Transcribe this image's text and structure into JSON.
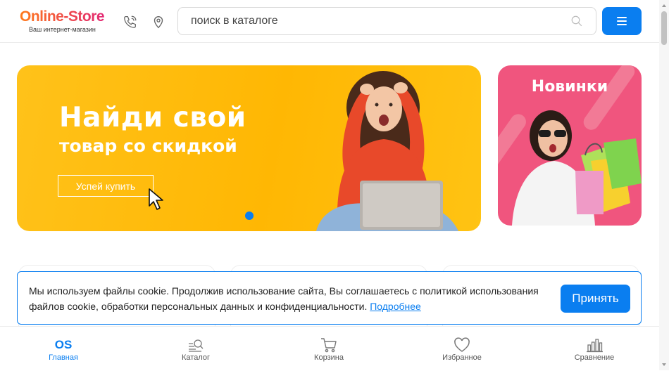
{
  "header": {
    "logo_name": "Online-Store",
    "logo_tagline": "Ваш интернет-магазин",
    "search_placeholder": "поиск в каталоге",
    "icons": [
      "phone-icon",
      "location-pin-icon",
      "search-icon",
      "menu-icon"
    ]
  },
  "banner": {
    "title_line1": "Найди свой",
    "title_line2": "товар со скидкой",
    "button_label": "Успей купить",
    "slides_count": 1,
    "active_slide": 1
  },
  "promo": {
    "title": "Новинки"
  },
  "cookie": {
    "text": "Мы используем файлы cookie. Продолжив использование сайта, Вы соглашаетесь с политикой использования файлов cookie, обработки персональных данных и конфиденциальности.",
    "link_label": "Подробнее",
    "accept_label": "Принять"
  },
  "bottom_nav": {
    "home_mark": "OS",
    "items": [
      {
        "label": "Главная",
        "icon": "home-logo-icon",
        "active": true
      },
      {
        "label": "Каталог",
        "icon": "catalog-search-icon",
        "active": false
      },
      {
        "label": "Корзина",
        "icon": "cart-icon",
        "active": false
      },
      {
        "label": "Избранное",
        "icon": "heart-icon",
        "active": false
      },
      {
        "label": "Сравнение",
        "icon": "compare-bars-icon",
        "active": false
      }
    ]
  },
  "colors": {
    "accent": "#0a7ef0",
    "banner_yellow": "#ffb703",
    "promo_pink": "#f0557e",
    "logo_gradient_start": "#ff7a1a",
    "logo_gradient_end": "#e0207a"
  }
}
